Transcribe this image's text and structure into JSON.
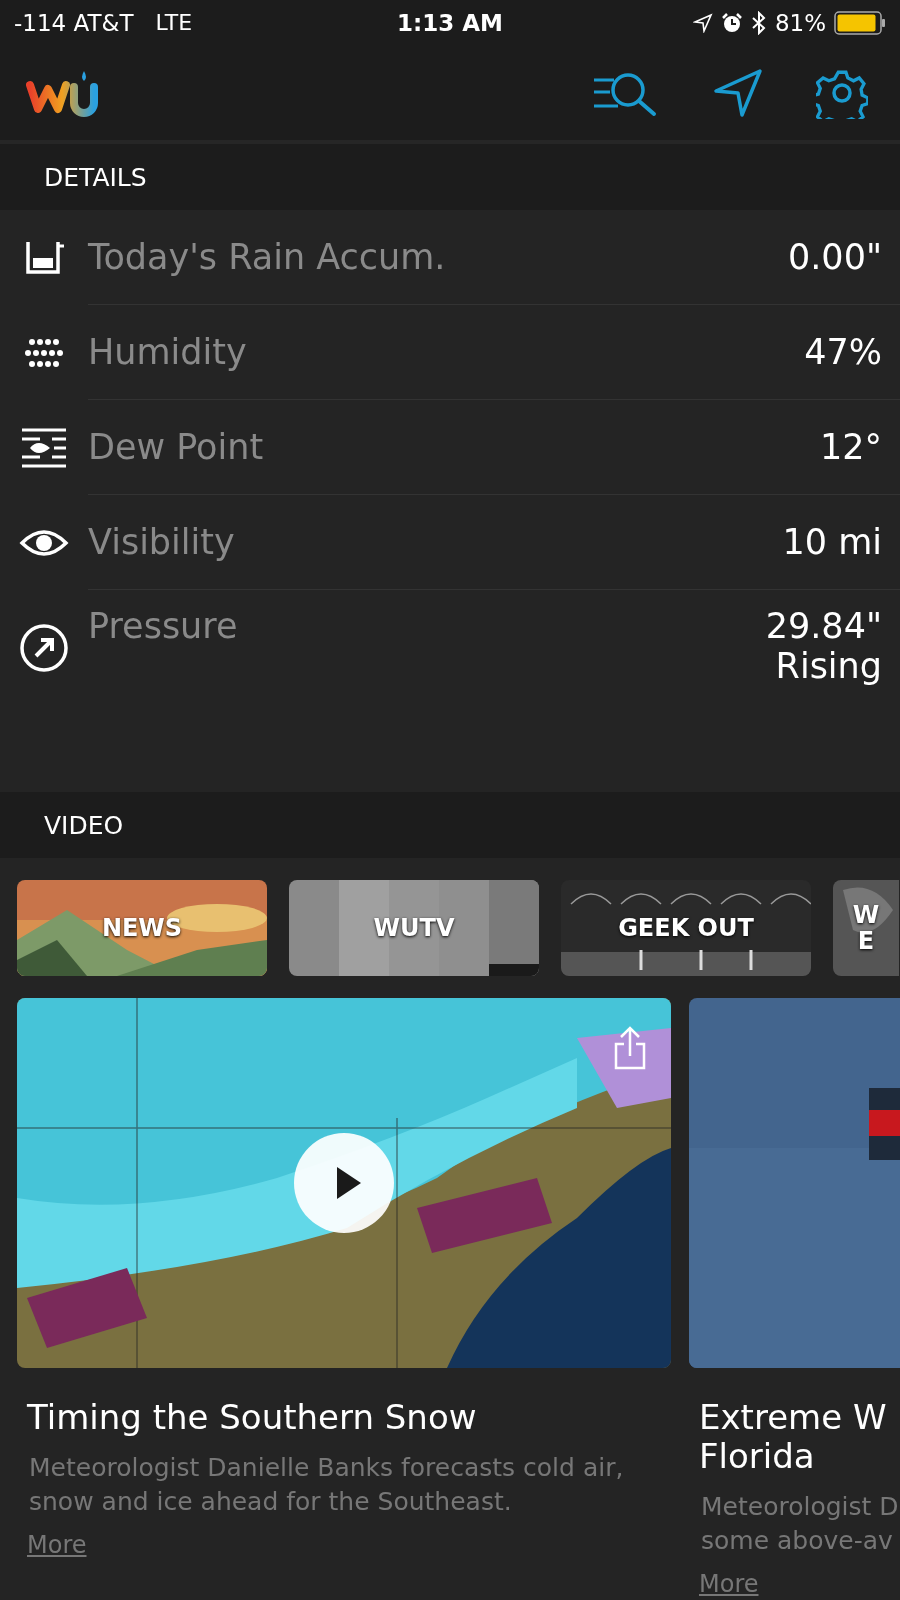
{
  "status_bar": {
    "carrier": "-114 AT&T",
    "network": "LTE",
    "time": "1:13 AM",
    "battery": "81%"
  },
  "details": {
    "title": "DETAILS",
    "rows": [
      {
        "kind": "rain",
        "label": "Today's Rain Accum.",
        "value": "0.00\""
      },
      {
        "kind": "humidity",
        "label": "Humidity",
        "value": "47%"
      },
      {
        "kind": "dew",
        "label": "Dew Point",
        "value": "12°"
      },
      {
        "kind": "visibility",
        "label": "Visibility",
        "value": "10 mi"
      },
      {
        "kind": "pressure",
        "label": "Pressure",
        "value": "29.84\"",
        "trend": "Rising"
      }
    ]
  },
  "video": {
    "title": "VIDEO",
    "categories": [
      {
        "kind": "mountains",
        "label": "NEWS"
      },
      {
        "kind": "bars",
        "label": "WUTV"
      },
      {
        "kind": "grid",
        "label": "GEEK OUT"
      },
      {
        "kind": "globe",
        "label": "W\nE"
      }
    ],
    "cards": [
      {
        "kind": "map",
        "title": "Timing the Southern Snow",
        "description": "Meteorologist Danielle Banks forecasts cold air, snow and ice ahead for the Southeast.",
        "link": "More"
      },
      {
        "kind": "plain",
        "title": "Extreme W\nFlorida",
        "description": "Meteorologist D\nsome above-av",
        "link": "More"
      }
    ]
  }
}
